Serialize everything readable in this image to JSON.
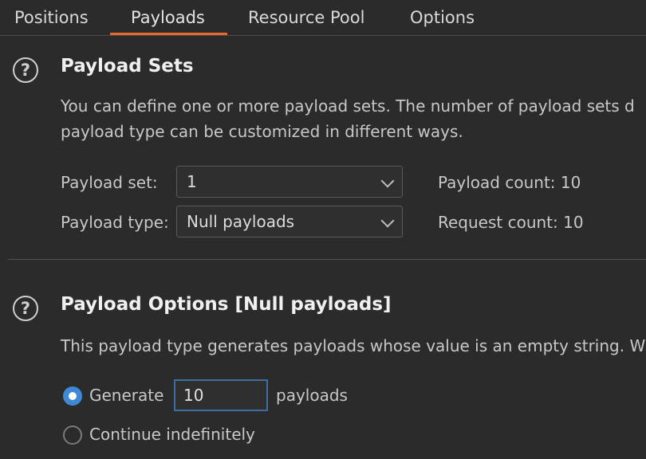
{
  "tabs": [
    {
      "label": "Positions"
    },
    {
      "label": "Payloads"
    },
    {
      "label": "Resource Pool"
    },
    {
      "label": "Options"
    }
  ],
  "active_tab": "Payloads",
  "colors": {
    "accent": "#e8692e",
    "radio": "#3f88d6"
  },
  "payload_sets": {
    "title": "Payload Sets",
    "desc_line1": "You can define one or more payload sets. The number of payload sets d",
    "desc_line2": "payload type can be customized in different ways.",
    "set_label": "Payload set:",
    "set_value": "1",
    "type_label": "Payload type:",
    "type_value": "Null payloads",
    "payload_count": "Payload count: 10",
    "request_count": "Request count: 10"
  },
  "payload_options": {
    "title": "Payload Options [Null payloads]",
    "desc": "This payload type generates payloads whose value is an empty string. W",
    "generate_label": "Generate",
    "generate_value": "10",
    "payloads_suffix": "payloads",
    "continue_label": "Continue indefinitely"
  },
  "icons": [
    "help-icon",
    "chevron-down-icon",
    "radio-icon"
  ]
}
